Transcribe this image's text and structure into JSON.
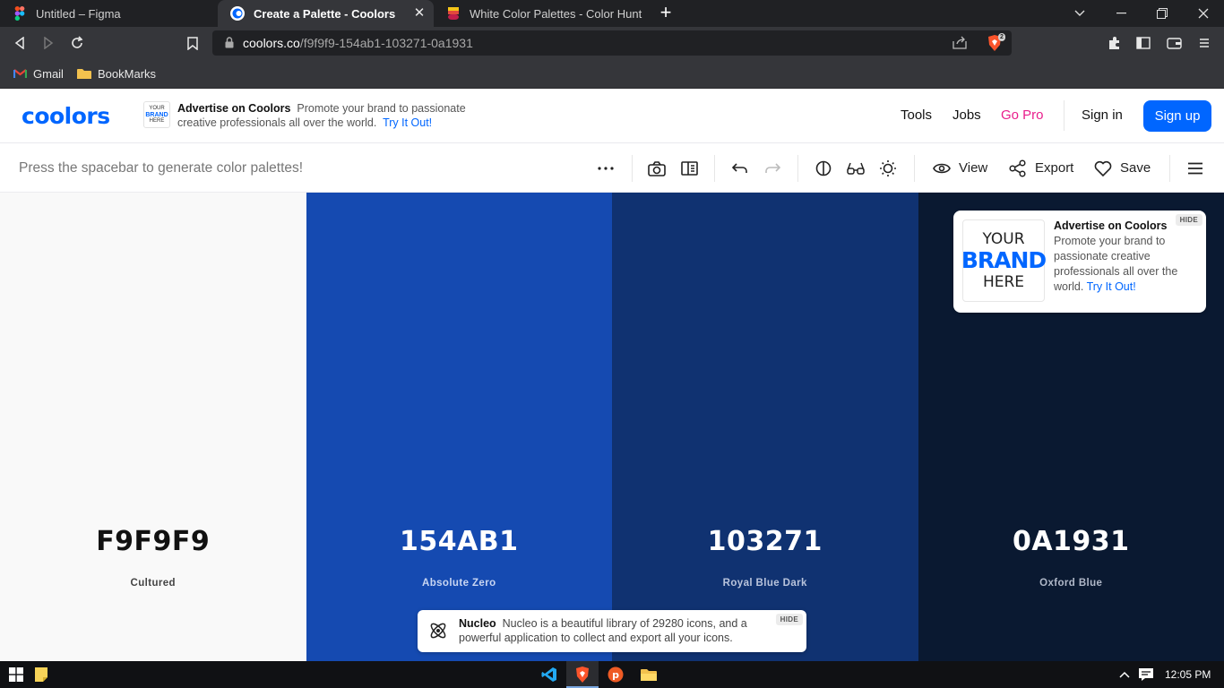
{
  "browser": {
    "tabs": [
      {
        "title": "Untitled – Figma",
        "icon": "figma-icon"
      },
      {
        "title": "Create a Palette - Coolors",
        "icon": "coolors-icon",
        "active": true
      },
      {
        "title": "White Color Palettes - Color Hunt",
        "icon": "colorhunt-icon"
      }
    ],
    "url_domain": "coolors.co",
    "url_path": "/f9f9f9-154ab1-103271-0a1931",
    "brave_badge": "2",
    "bookmarks": [
      {
        "label": "Gmail",
        "icon": "gmail-icon"
      },
      {
        "label": "BookMarks",
        "icon": "folder-icon"
      }
    ]
  },
  "header": {
    "logo": "coolors",
    "ad_mini": {
      "line1": "YOUR",
      "line2": "BRAND",
      "line3": "HERE"
    },
    "ad_title": "Advertise on Coolors",
    "ad_desc": "Promote your brand to passionate creative professionals all over the world.",
    "ad_link": "Try It Out!",
    "nav": {
      "tools": "Tools",
      "jobs": "Jobs",
      "go_pro": "Go Pro",
      "sign_in": "Sign in",
      "sign_up": "Sign up"
    }
  },
  "subbar": {
    "hint": "Press the spacebar to generate color palettes!",
    "view": "View",
    "export": "Export",
    "save": "Save"
  },
  "palette": [
    {
      "hex": "F9F9F9",
      "name": "Cultured",
      "bg": "#f9f9f9",
      "fg": "#111111",
      "sub": "#444444"
    },
    {
      "hex": "154AB1",
      "name": "Absolute Zero",
      "bg": "#154ab1",
      "fg": "#ffffff",
      "sub": "#c9d6f2"
    },
    {
      "hex": "103271",
      "name": "Royal Blue Dark",
      "bg": "#103271",
      "fg": "#ffffff",
      "sub": "#b9c4dc"
    },
    {
      "hex": "0A1931",
      "name": "Oxford Blue",
      "bg": "#0a1931",
      "fg": "#ffffff",
      "sub": "#b0b8c8"
    }
  ],
  "ad_card": {
    "brand_line1": "YOUR",
    "brand_line2": "BRAND",
    "brand_line3": "HERE",
    "title": "Advertise on Coolors",
    "desc": "Promote your brand to passionate creative professionals all over the world.",
    "link": "Try It Out!",
    "hide": "HIDE"
  },
  "nucleo": {
    "title": "Nucleo",
    "desc": "Nucleo is a beautiful library of 29280 icons, and a powerful application to collect and export all your icons.",
    "hide": "HIDE"
  },
  "taskbar": {
    "time": "12:05 PM"
  },
  "colors": {
    "accent": "#0066ff",
    "go_pro": "#e91e8c"
  }
}
